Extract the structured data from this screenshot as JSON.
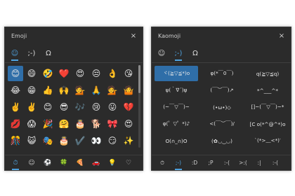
{
  "emoji_panel": {
    "title": "Emoji",
    "close": "×",
    "tabs": [
      {
        "name": "emoji-tab",
        "glyph": "☺"
      },
      {
        "name": "kaomoji-tab",
        "glyph": ";-)"
      },
      {
        "name": "symbols-tab",
        "glyph": "Ω"
      }
    ],
    "grid": [
      "😊",
      "😄",
      "🤣",
      "❤️",
      "😍",
      "😒",
      "👌",
      "😘",
      "😂",
      "😁",
      "👍",
      "🙌",
      "💁",
      "🙏",
      "💁",
      "🤷",
      "✌️",
      "✌️",
      "😊",
      "😎",
      "🎶",
      "😢",
      "😛",
      "💔",
      "💋",
      "😱",
      "🎉",
      "🤗",
      "🎂",
      "🐕",
      "🎀",
      "😍",
      "🎊",
      "😺",
      "🎭",
      "🎂",
      "✔️",
      "👀",
      "😏",
      "✨"
    ],
    "bottom": [
      "⏱",
      "☺",
      "⚽",
      "🍀",
      "🍕",
      "🚗",
      "💡",
      "♡"
    ]
  },
  "kaomoji_panel": {
    "title": "Kaomoji",
    "close": "×",
    "tabs": [
      {
        "name": "emoji-tab",
        "glyph": "☺"
      },
      {
        "name": "kaomoji-tab",
        "glyph": ";-)"
      },
      {
        "name": "symbols-tab",
        "glyph": "Ω"
      }
    ],
    "grid": [
      "ヾ(≧▽≦*)o",
      "φ(*￣0￣)",
      "q(≧▽≦q)",
      "ψ(｀∇´)ψ",
      "(￣︶￣)↗",
      "*^___^*",
      "(~￣▽￣)~",
      "(•ω•)◇",
      "[]~(￣▽￣)~*",
      "φ(゜▽゜*)♪",
      "<(￣︶￣)/",
      "[C o(*^@^*)o",
      "O(∩_∩)O",
      "(✿◡‿◡)",
      "`(*>﹏<*)′"
    ],
    "bottom": [
      "⏱",
      ";-)",
      ":D",
      ";P",
      ":-(",
      ">:(",
      ":|",
      ":-("
    ]
  }
}
